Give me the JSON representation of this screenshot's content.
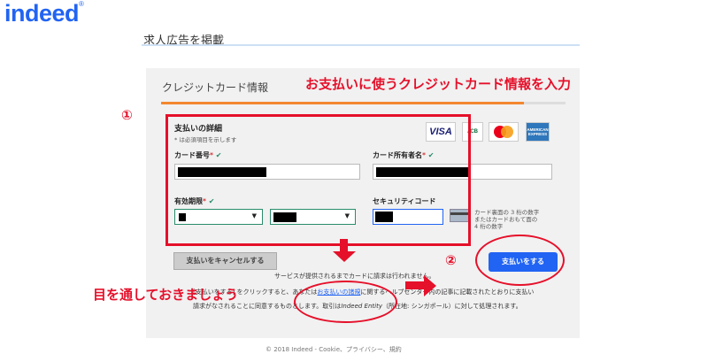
{
  "header": {
    "logo_text": "indeed",
    "logo_mark": "®",
    "page_title": "求人広告を掲載"
  },
  "card": {
    "title": "クレジットカード情報",
    "section_title": "支払いの詳細",
    "required_note": "* は必須項目を示します",
    "card_number_label": "カード番号",
    "cardholder_label": "カード所有者名",
    "expiry_label": "有効期限",
    "security_label": "セキュリティコード",
    "required_mark": "*",
    "check_mark": "✔",
    "security_help": [
      "カード裏面の 3 桁の数字",
      "またはカードおもて面の",
      "4 桁の数字"
    ],
    "logos": {
      "visa": "VISA",
      "jcb": "JCB",
      "amex": "AMERICAN EXPRESS"
    }
  },
  "buttons": {
    "cancel": "支払いをキャンセルする",
    "pay": "支払いをする"
  },
  "notes": {
    "line1": "サービスが提供されるまでカードに請求は行われません。",
    "line2_a": "[支払いをする] をクリックすると、あなたは",
    "line2_link": "お支払いの諸規",
    "line2_b": "に関するヘルプセンター内の記事に記載されたとおりに支払い",
    "line3_a": "請求がなされることに同意するものとします。取引は",
    "line3_em": "Indeed Entity",
    "line3_b": "（所在地: シンガポール）に対して処理されます。",
    "footer": "© 2018 Indeed - Cookie、プライバシー、規約"
  },
  "annotations": {
    "main": "お支払いに使うクレジットカード情報を入力",
    "step1": "①",
    "step2": "②",
    "bottom": "目を通しておきましょう"
  },
  "colors": {
    "brand": "#2164f3",
    "annotation": "#e5102a",
    "accent_line": "#f3872f"
  }
}
